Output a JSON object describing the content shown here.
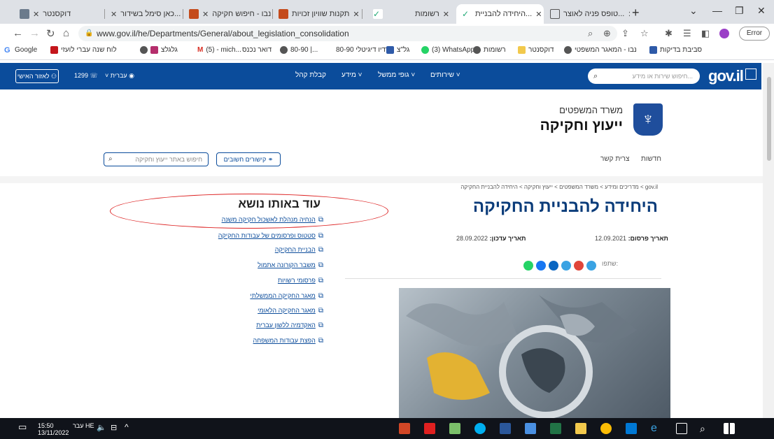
{
  "browser": {
    "tabs": [
      {
        "title": "דוקסנטר",
        "active": false
      },
      {
        "title": "כאן סימל בשידור...",
        "active": false
      },
      {
        "title": "נבו - חיפוש חקיקה",
        "active": false
      },
      {
        "title": "תקנות שוויון זכויות",
        "active": false
      },
      {
        "title": "רשומות",
        "active": false
      },
      {
        "title": "היחידה להבניית...",
        "active": true
      },
      {
        "title": "טופס פניה לאוצר...",
        "active": false
      }
    ],
    "url": "www.gov.il/he/Departments/General/about_legislation_consolidation",
    "error_label": "Error",
    "bookmarks": [
      "Google",
      "לוח שנה עברי לועזי",
      "גלגלצ",
      "(5) - mich...",
      "דואר נכנס",
      "80-90 |...",
      "רדיו דיגיטלי 80-90",
      "גל\"צ",
      "(3) WhatsApp",
      "רשומות",
      "דוקסנטר",
      "נבו - המאגר המשפטי",
      "סביבת בדיקות"
    ]
  },
  "gov": {
    "logo": "gov.il",
    "search_placeholder": "חיפוש שירות או מידע...",
    "nav": [
      "שירותים",
      "גופי ממשל",
      "מידע",
      "קבלת קהל"
    ],
    "language": "עברית",
    "phone": "1299",
    "personal_area": "לאזור האישי"
  },
  "office": {
    "ministry": "משרד המשפטים",
    "name": "ייעוץ וחקיקה",
    "subnav": [
      "חדשות",
      "צרית קשר"
    ],
    "search_placeholder": "חיפוש באתר ייעוץ וחקיקה",
    "links_button": "קישורים חשובים"
  },
  "page": {
    "breadcrumb": "gov.il > מדריכים ומידע > משרד המשפטים > ייעוץ וחקיקה > היחידה להבניית החקיקה",
    "title": "היחידה להבניית החקיקה",
    "published_label": "תאריך פרסום:",
    "published": "12.09.2021",
    "updated_label": "תאריך עדכון:",
    "updated": "28.09.2022",
    "share_label": "שתפו:"
  },
  "related": {
    "title": "עוד באותו נושא",
    "links": [
      "הנחיה מנהלת לאשכול חקיקה משנה",
      "סטטוס ופרסומים של עבודות החקיקה",
      "הבניית החקיקה",
      "משבר הקורונה אתמול",
      "פרסומי רשויות",
      "מאגר החקיקה הממשלתי",
      "מאגר החקיקה הלאומי",
      "האקדמיה ללשון עברית",
      "הפצת עבודות המשפחה"
    ]
  },
  "taskbar": {
    "time": "15:50",
    "date": "13/11/2022",
    "lang": "עבר HE"
  }
}
